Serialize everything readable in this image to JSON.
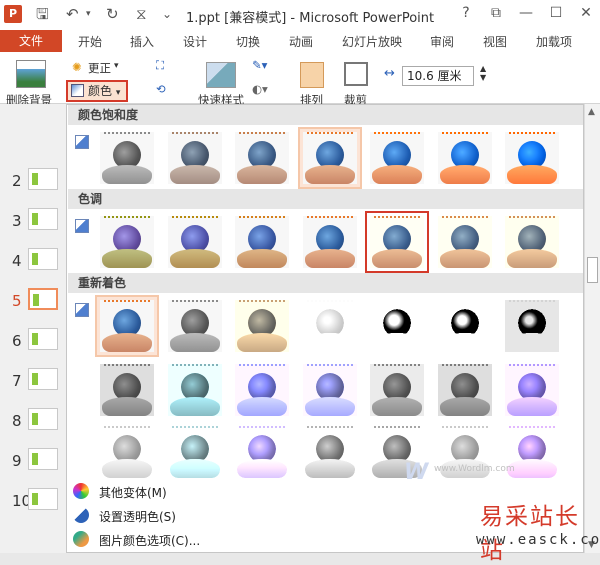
{
  "titlebar": {
    "logo": "P",
    "file_title": "1.ppt [兼容模式] - Microsoft PowerPoint",
    "help": "?",
    "restore": "⧉",
    "minimize": "—",
    "maximize": "☐",
    "close": "✕"
  },
  "tabs": {
    "file": "文件",
    "items": [
      "开始",
      "插入",
      "设计",
      "切换",
      "动画",
      "幻灯片放映",
      "审阅",
      "视图",
      "加载项"
    ]
  },
  "ribbon": {
    "remove_bg": "删除背景",
    "corrections": "更正",
    "color": "颜色",
    "quick_styles": "快速样式",
    "arrange": "排列",
    "crop": "裁剪",
    "width_value": "10.6 厘米"
  },
  "slides": [
    {
      "num": "2",
      "active": false
    },
    {
      "num": "3",
      "active": false
    },
    {
      "num": "4",
      "active": false
    },
    {
      "num": "5",
      "active": true
    },
    {
      "num": "6",
      "active": false
    },
    {
      "num": "7",
      "active": false
    },
    {
      "num": "8",
      "active": false
    },
    {
      "num": "9",
      "active": false
    },
    {
      "num": "10",
      "active": false
    }
  ],
  "dropdown": {
    "sections": [
      {
        "title": "颜色饱和度",
        "rows": [
          [
            "s0",
            "s1",
            "s2",
            "s3",
            "s4",
            "s5",
            "s6"
          ]
        ],
        "highlight": 3
      },
      {
        "title": "色调",
        "rows": [
          [
            "t0",
            "t1",
            "t2",
            "t3",
            "t4",
            "t5",
            "t6"
          ]
        ],
        "selected": 4
      },
      {
        "title": "重新着色",
        "rows": [
          [
            "r0",
            "r1",
            "r2",
            "r3",
            "r4",
            "r5",
            "r6"
          ],
          [
            "g0",
            "g1",
            "g2",
            "g3",
            "g4",
            "g5",
            "g6"
          ],
          [
            "l0",
            "l1",
            "l2",
            "l3",
            "l4",
            "l5",
            "l6"
          ]
        ],
        "highlight": 0
      }
    ],
    "menu": [
      {
        "label": "其他变体(M)",
        "icon": "color-wheel-icon"
      },
      {
        "label": "设置透明色(S)",
        "icon": "transparent-color-icon"
      },
      {
        "label": "图片颜色选项(C)...",
        "icon": "picture-color-options-icon"
      }
    ]
  },
  "watermark": {
    "logo": "W",
    "url_small": "www.Wordlm.com",
    "cn": "易采站长站",
    "url": "www.easck.com"
  }
}
